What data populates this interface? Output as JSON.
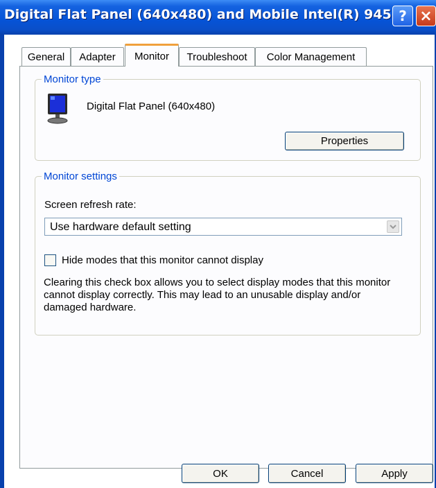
{
  "window": {
    "title": "Digital Flat Panel (640x480) and Mobile Intel(R) 945 ...",
    "help_icon_glyph": "?",
    "close_icon_glyph": "×"
  },
  "tabs": [
    {
      "label": "General"
    },
    {
      "label": "Adapter"
    },
    {
      "label": "Monitor"
    },
    {
      "label": "Troubleshoot"
    },
    {
      "label": "Color Management"
    }
  ],
  "active_tab": "Monitor",
  "monitor_type": {
    "legend": "Monitor type",
    "icon": "monitor-icon",
    "name": "Digital Flat Panel (640x480)",
    "properties_label": "Properties"
  },
  "monitor_settings": {
    "legend": "Monitor settings",
    "refresh_label": "Screen refresh rate:",
    "refresh_value": "Use hardware default setting",
    "hide_modes_label": "Hide modes that this monitor cannot display",
    "hide_modes_checked": false,
    "description": "Clearing this check box allows you to select display modes that this monitor cannot display correctly. This may lead to an unusable display and/or damaged hardware."
  },
  "footer": {
    "ok_label": "OK",
    "cancel_label": "Cancel",
    "apply_label": "Apply"
  },
  "colors": {
    "titlebar": "#0653d6",
    "legend_text": "#0046d5",
    "active_tab_accent": "#f0a03c",
    "close_button": "#c63a1b"
  }
}
